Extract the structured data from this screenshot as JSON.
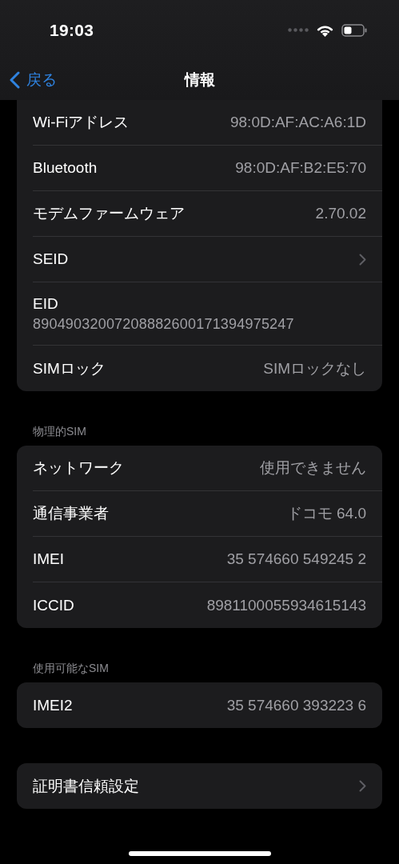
{
  "status_bar": {
    "time": "19:03"
  },
  "nav": {
    "back": "戻る",
    "title": "情報"
  },
  "groups": [
    {
      "rows": [
        {
          "kind": "value",
          "label": "Wi-Fiアドレス",
          "value": "98:0D:AF:AC:A6:1D"
        },
        {
          "kind": "value",
          "label": "Bluetooth",
          "value": "98:0D:AF:B2:E5:70"
        },
        {
          "kind": "value",
          "label": "モデムファームウェア",
          "value": "2.70.02"
        },
        {
          "kind": "link",
          "label": "SEID"
        },
        {
          "kind": "stacked",
          "label": "EID",
          "value": "89049032007208882600171394975247"
        },
        {
          "kind": "value",
          "label": "SIMロック",
          "value": "SIMロックなし"
        }
      ]
    },
    {
      "header": "物理的SIM",
      "rows": [
        {
          "kind": "value",
          "label": "ネットワーク",
          "value": "使用できません"
        },
        {
          "kind": "value",
          "label": "通信事業者",
          "value": "ドコモ 64.0"
        },
        {
          "kind": "value",
          "label": "IMEI",
          "value": "35 574660 549245 2"
        },
        {
          "kind": "value",
          "label": "ICCID",
          "value": "8981100055934615143"
        }
      ]
    },
    {
      "header": "使用可能なSIM",
      "rows": [
        {
          "kind": "value",
          "label": "IMEI2",
          "value": "35 574660 393223 6"
        }
      ]
    },
    {
      "rows": [
        {
          "kind": "link",
          "label": "証明書信頼設定"
        }
      ]
    }
  ]
}
